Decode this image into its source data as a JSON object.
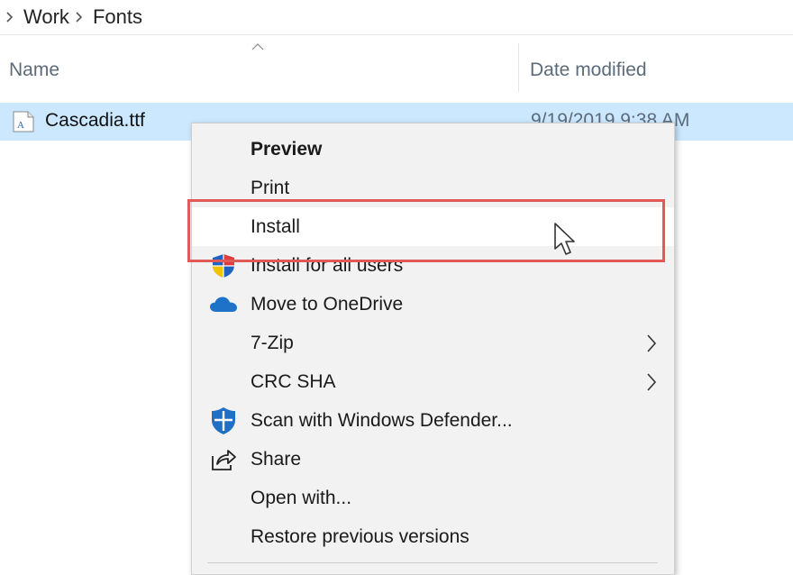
{
  "breadcrumb": {
    "items": [
      "Work",
      "Fonts"
    ]
  },
  "columns": {
    "name": "Name",
    "date_modified": "Date modified"
  },
  "file": {
    "name": "Cascadia.ttf",
    "date": "9/19/2019 9:38 AM"
  },
  "context_menu": {
    "items": [
      {
        "label": "Preview",
        "icon": "",
        "submenu": false,
        "bold": true
      },
      {
        "label": "Print",
        "icon": "",
        "submenu": false
      },
      {
        "label": "Install",
        "icon": "",
        "submenu": false,
        "hover": true
      },
      {
        "label": "Install for all users",
        "icon": "uac-shield-icon",
        "submenu": false
      },
      {
        "label": "Move to OneDrive",
        "icon": "onedrive-cloud-icon",
        "submenu": false
      },
      {
        "label": "7-Zip",
        "icon": "",
        "submenu": true
      },
      {
        "label": "CRC SHA",
        "icon": "",
        "submenu": true
      },
      {
        "label": "Scan with Windows Defender...",
        "icon": "defender-shield-icon",
        "submenu": false
      },
      {
        "label": "Share",
        "icon": "share-icon",
        "submenu": false
      },
      {
        "label": "Open with...",
        "icon": "",
        "submenu": false
      },
      {
        "label": "Restore previous versions",
        "icon": "",
        "submenu": false
      }
    ]
  },
  "colors": {
    "selection": "#cce8ff",
    "highlight_box": "#e05a5a",
    "onedrive": "#1e73c8",
    "defender": "#1f6fc5"
  }
}
